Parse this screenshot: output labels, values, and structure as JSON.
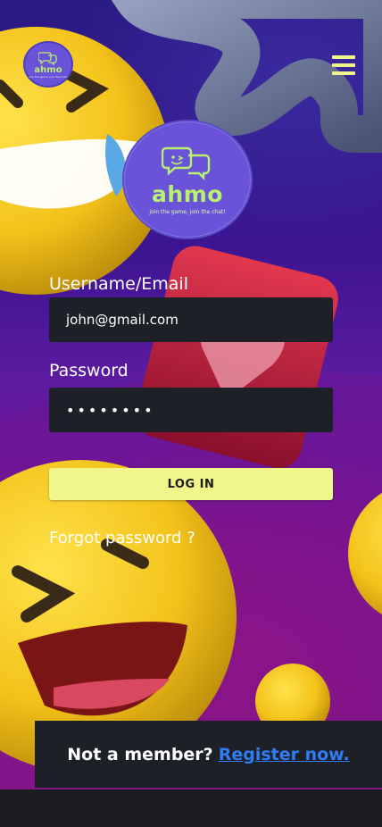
{
  "brand": {
    "name": "ahmo",
    "tagline": "join the game, join the chat!",
    "accent": "#b9f06f",
    "logo_bg": "#6a53d8"
  },
  "header": {
    "menu_icon": "hamburger-menu-icon"
  },
  "form": {
    "username_label": "Username/Email",
    "username_value": "john@gmail.com",
    "password_label": "Password",
    "password_value": "••••••••",
    "login_label": "LOG IN",
    "forgot_label": "Forgot password ?"
  },
  "register": {
    "prompt": "Not a member?",
    "link_label": "Register now."
  },
  "colors": {
    "button_bg": "#f1f68a",
    "input_bg": "#1d2026",
    "link": "#2f7df6"
  }
}
